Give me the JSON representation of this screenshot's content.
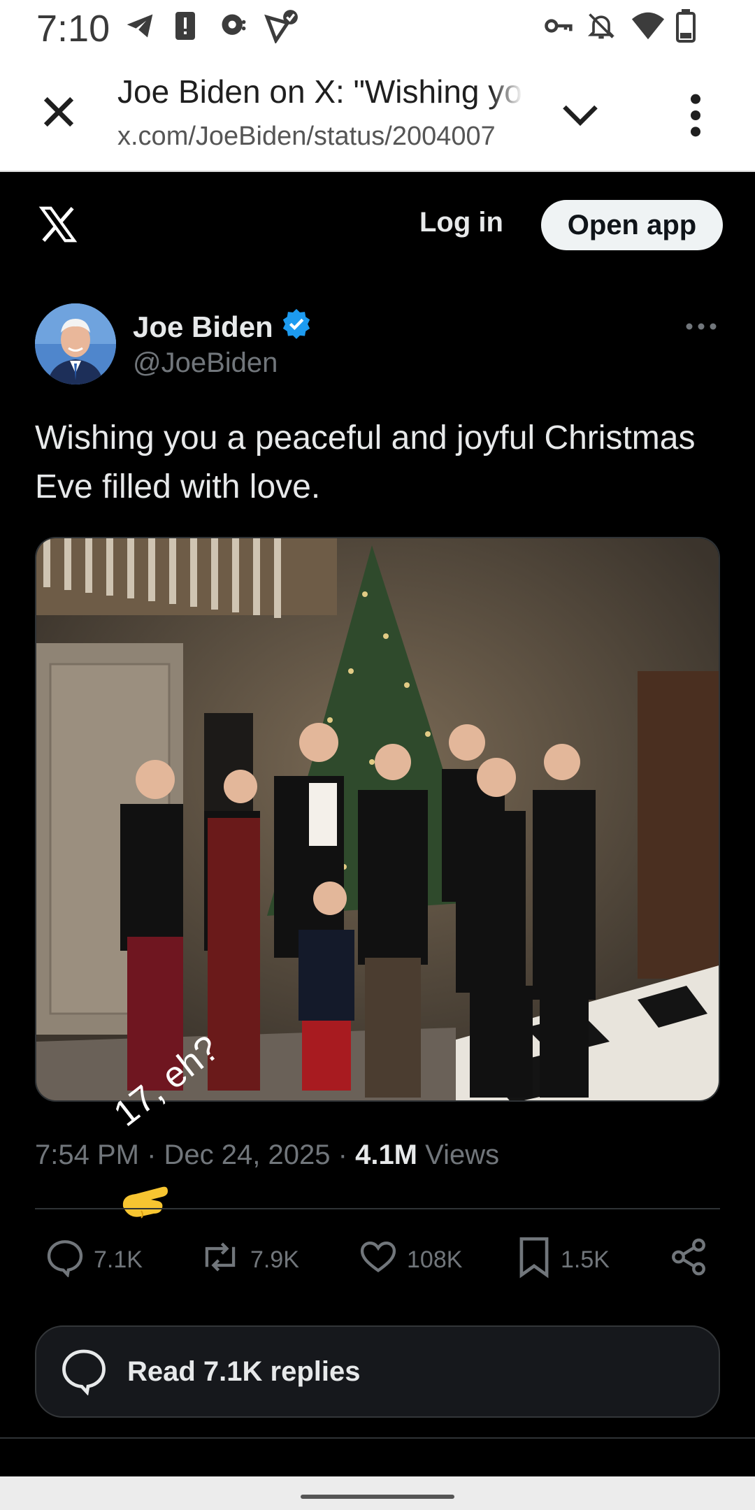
{
  "status_bar": {
    "time": "7:10",
    "icons_left": [
      "telegram-icon",
      "alert-icon",
      "speech-icon",
      "send-check-icon"
    ],
    "icons_right": [
      "vpn-key-icon",
      "notifications-off-icon",
      "wifi-icon",
      "battery-icon"
    ]
  },
  "custom_tab": {
    "title": "Joe Biden on X: \"Wishing you a peaceful and joyful",
    "url": "x.com/JoeBiden/status/2004007"
  },
  "x_header": {
    "login_label": "Log in",
    "open_app_label": "Open app"
  },
  "post": {
    "author_name": "Joe Biden",
    "author_handle": "@JoeBiden",
    "text": "Wishing you a peaceful and joyful Christmas Eve filled with love.",
    "time": "7:54 PM",
    "date": "Dec 24, 2025",
    "separator": "·",
    "views_count": "4.1M",
    "views_label": "Views",
    "annotation": "17, eh?"
  },
  "actions": {
    "replies": "7.1K",
    "reposts": "7.9K",
    "likes": "108K",
    "bookmarks": "1.5K"
  },
  "read_replies_label": "Read 7.1K replies",
  "colors": {
    "background": "#000000",
    "text_primary": "#e7e9ea",
    "text_secondary": "#71767b",
    "verified_blue": "#1d9bf0",
    "divider": "#2f3336"
  }
}
